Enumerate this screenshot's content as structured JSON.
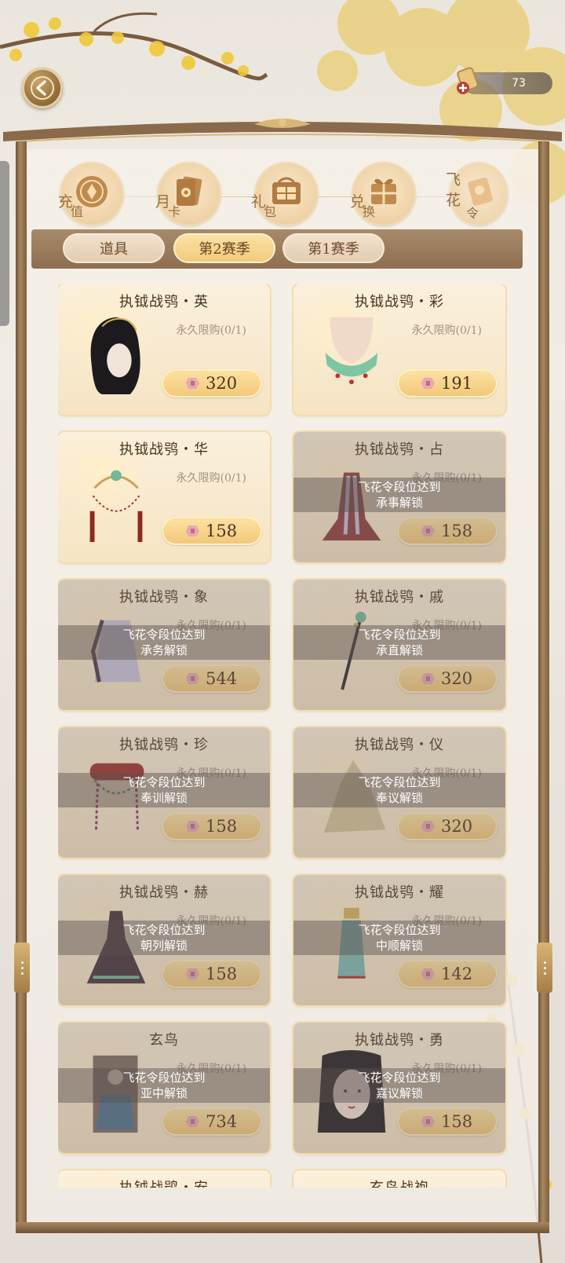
{
  "header": {
    "currency_value": "73",
    "currency_icon": "flying-flower-token-icon"
  },
  "categories": [
    {
      "id": "recharge",
      "char1": "充",
      "char2": "值",
      "icon": "coin-icon"
    },
    {
      "id": "monthly-card",
      "char1": "月",
      "char2": "卡",
      "icon": "flower-card-icon"
    },
    {
      "id": "gift-pack",
      "char1": "礼",
      "char2": "包",
      "icon": "gift-box-icon"
    },
    {
      "id": "exchange",
      "char1": "兑",
      "char2": "换",
      "icon": "exchange-gift-icon"
    },
    {
      "id": "feihua-token",
      "char1": "飞",
      "char2": "花",
      "char3": "令",
      "icon": "scroll-icon"
    }
  ],
  "tabs": [
    {
      "label": "道具",
      "active": false
    },
    {
      "label": "第2赛季",
      "active": true
    },
    {
      "label": "第1赛季",
      "active": false
    }
  ],
  "items": [
    {
      "name": "执钺战鸮・英",
      "limit": "永久限购(0/1)",
      "price": "320",
      "locked": false,
      "lock_line1": "",
      "lock_line2": "",
      "image": "black-hairstyle"
    },
    {
      "name": "执钺战鸮・彩",
      "limit": "永久限购(0/1)",
      "price": "191",
      "locked": false,
      "lock_line1": "",
      "lock_line2": "",
      "image": "jade-necklace"
    },
    {
      "name": "执钺战鸮・华",
      "limit": "永久限购(0/1)",
      "price": "158",
      "locked": false,
      "lock_line1": "",
      "lock_line2": "",
      "image": "beaded-headpiece"
    },
    {
      "name": "执钺战鸮・占",
      "limit": "永久限购(0/1)",
      "price": "158",
      "locked": true,
      "lock_line1": "飞花令段位达到",
      "lock_line2": "承事解锁",
      "image": "red-cape"
    },
    {
      "name": "执钺战鸮・象",
      "limit": "永久限购(0/1)",
      "price": "544",
      "locked": true,
      "lock_line1": "飞花令段位达到",
      "lock_line2": "承务解锁",
      "image": "lavender-robe"
    },
    {
      "name": "执钺战鸮・戚",
      "limit": "永久限购(0/1)",
      "price": "320",
      "locked": true,
      "lock_line1": "飞花令段位达到",
      "lock_line2": "承直解锁",
      "image": "jeweled-staff"
    },
    {
      "name": "执钺战鸮・珍",
      "limit": "永久限购(0/1)",
      "price": "158",
      "locked": true,
      "lock_line1": "飞花令段位达到",
      "lock_line2": "奉训解锁",
      "image": "ornate-crown"
    },
    {
      "name": "执钺战鸮・仪",
      "limit": "永久限购(0/1)",
      "price": "320",
      "locked": true,
      "lock_line1": "飞花令段位达到",
      "lock_line2": "奉议解锁",
      "image": "golden-veil"
    },
    {
      "name": "执钺战鸮・赫",
      "limit": "永久限购(0/1)",
      "price": "158",
      "locked": true,
      "lock_line1": "飞花令段位达到",
      "lock_line2": "朝列解锁",
      "image": "dark-gown"
    },
    {
      "name": "执钺战鸮・耀",
      "limit": "永久限购(0/1)",
      "price": "142",
      "locked": true,
      "lock_line1": "飞花令段位达到",
      "lock_line2": "中顺解锁",
      "image": "teal-outfit"
    },
    {
      "name": "玄鸟",
      "limit": "永久限购(0/1)",
      "price": "734",
      "locked": true,
      "lock_line1": "飞花令段位达到",
      "lock_line2": "亚中解锁",
      "image": "portrait-card"
    },
    {
      "name": "执钺战鸮・勇",
      "limit": "永久限购(0/1)",
      "price": "158",
      "locked": true,
      "lock_line1": "飞花令段位达到",
      "lock_line2": "嘉议解锁",
      "image": "face-makeup"
    },
    {
      "name": "执钺战鸮・安",
      "limit": "",
      "price": "",
      "locked": false,
      "lock_line1": "",
      "lock_line2": "",
      "image": ""
    },
    {
      "name": "玄鸟战袍",
      "limit": "",
      "price": "",
      "locked": false,
      "lock_line1": "",
      "lock_line2": "",
      "image": ""
    }
  ],
  "colors": {
    "accent_gold": "#f2c777",
    "frame_brown": "#8e6e50",
    "text_dark": "#4a3320"
  }
}
